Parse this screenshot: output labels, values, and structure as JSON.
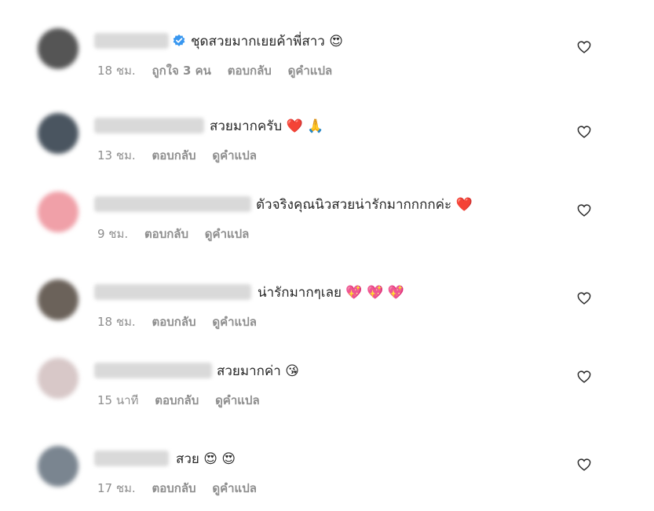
{
  "comments": [
    {
      "text": "ชุดสวยมากเยยค้าพี่สาว",
      "emoji": "😍",
      "time": "18 ชม.",
      "likes": "ถูกใจ 3 คน",
      "reply": "ตอบกลับ",
      "translate": "ดูคำแปล",
      "verified": true,
      "avatar_color": "#555555"
    },
    {
      "text": "สวยมากครับ",
      "emoji": "❤️ 🙏",
      "time": "13 ชม.",
      "reply": "ตอบกลับ",
      "translate": "ดูคำแปล",
      "verified": false,
      "avatar_color": "#4a5560"
    },
    {
      "text": "ตัวจริงคุณนิวสวยน่ารักมากกกกค่ะ",
      "emoji": "❤️",
      "time": "9 ชม.",
      "reply": "ตอบกลับ",
      "translate": "ดูคำแปล",
      "verified": false,
      "avatar_color": "#f0a0a8"
    },
    {
      "text": "น่ารักมากๆเลย",
      "emoji": "💖 💖 💖",
      "time": "18 ชม.",
      "reply": "ตอบกลับ",
      "translate": "ดูคำแปล",
      "verified": false,
      "avatar_color": "#6b625a"
    },
    {
      "text": "สวยมากค่า",
      "emoji": "😘",
      "time": "15 นาที",
      "reply": "ตอบกลับ",
      "translate": "ดูคำแปล",
      "verified": false,
      "avatar_color": "#d8c8c8"
    },
    {
      "text": "สวย",
      "emoji": "😍 😍",
      "time": "17 ชม.",
      "reply": "ตอบกลับ",
      "translate": "ดูคำแปล",
      "verified": false,
      "avatar_color": "#7a8590"
    }
  ],
  "colors": {
    "text": "#262626",
    "meta": "#8e8e8e",
    "verified": "#3897f0"
  }
}
